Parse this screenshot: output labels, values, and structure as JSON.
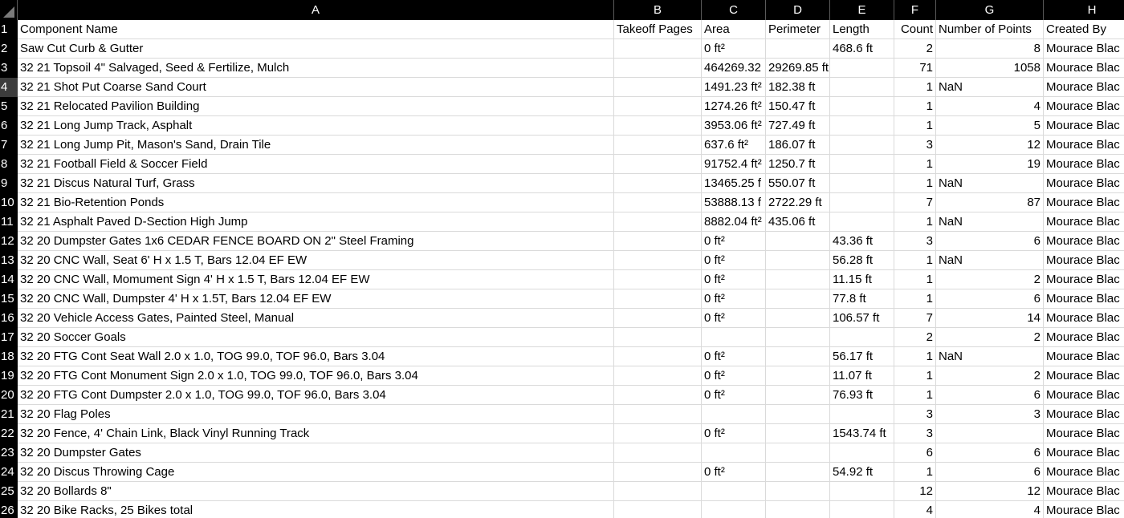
{
  "columns": [
    "A",
    "B",
    "C",
    "D",
    "E",
    "F",
    "G",
    "H"
  ],
  "selected_row": "4",
  "rows": [
    {
      "rn": "1",
      "a": "Component Name",
      "b": "Takeoff Pages",
      "c": "Area",
      "d": "Perimeter",
      "e": "Length",
      "f": "Count",
      "g": "Number of Points",
      "h": "Created By"
    },
    {
      "rn": "2",
      "a": "Saw Cut Curb & Gutter",
      "b": "",
      "c": "0 ft²",
      "d": "",
      "e": "468.6 ft",
      "f": "2",
      "g": "8",
      "h": "Mourace Blac"
    },
    {
      "rn": "3",
      "a": "32 21 Topsoil 4\" Salvaged, Seed & Fertilize, Mulch",
      "b": "",
      "c": "464269.32",
      "d": "29269.85 ft",
      "e": "",
      "f": "71",
      "g": "1058",
      "h": "Mourace Blac"
    },
    {
      "rn": "4",
      "a": "32 21 Shot Put Coarse Sand Court",
      "b": "",
      "c": "1491.23 ft²",
      "d": "182.38 ft",
      "e": "",
      "f": "1",
      "g": "NaN",
      "h": "Mourace Blac"
    },
    {
      "rn": "5",
      "a": "32 21 Relocated Pavilion Building",
      "b": "",
      "c": "1274.26 ft²",
      "d": "150.47 ft",
      "e": "",
      "f": "1",
      "g": "4",
      "h": "Mourace Blac"
    },
    {
      "rn": "6",
      "a": "32 21 Long Jump Track, Asphalt",
      "b": "",
      "c": "3953.06 ft²",
      "d": "727.49 ft",
      "e": "",
      "f": "1",
      "g": "5",
      "h": "Mourace Blac"
    },
    {
      "rn": "7",
      "a": "32 21 Long Jump Pit, Mason's Sand, Drain Tile",
      "b": "",
      "c": "637.6 ft²",
      "d": "186.07 ft",
      "e": "",
      "f": "3",
      "g": "12",
      "h": "Mourace Blac"
    },
    {
      "rn": "8",
      "a": "32 21 Football Field & Soccer Field",
      "b": "",
      "c": "91752.4 ft²",
      "d": "1250.7 ft",
      "e": "",
      "f": "1",
      "g": "19",
      "h": "Mourace Blac"
    },
    {
      "rn": "9",
      "a": "32 21 Discus Natural Turf, Grass",
      "b": "",
      "c": "13465.25 f",
      "d": "550.07 ft",
      "e": "",
      "f": "1",
      "g": "NaN",
      "h": "Mourace Blac"
    },
    {
      "rn": "10",
      "a": "32 21 Bio-Retention Ponds",
      "b": "",
      "c": "53888.13 f",
      "d": "2722.29 ft",
      "e": "",
      "f": "7",
      "g": "87",
      "h": "Mourace Blac"
    },
    {
      "rn": "11",
      "a": "32 21 Asphalt Paved D-Section High Jump",
      "b": "",
      "c": "8882.04 ft²",
      "d": "435.06 ft",
      "e": "",
      "f": "1",
      "g": "NaN",
      "h": "Mourace Blac"
    },
    {
      "rn": "12",
      "a": "32 20 Dumpster Gates 1x6 CEDAR FENCE BOARD ON 2\" Steel Framing",
      "b": "",
      "c": "0 ft²",
      "d": "",
      "e": "43.36 ft",
      "f": "3",
      "g": "6",
      "h": "Mourace Blac"
    },
    {
      "rn": "13",
      "a": "32 20 CNC Wall, Seat 6' H x 1.5 T, Bars 12.04 EF EW",
      "b": "",
      "c": "0 ft²",
      "d": "",
      "e": "56.28 ft",
      "f": "1",
      "g": "NaN",
      "h": "Mourace Blac"
    },
    {
      "rn": "14",
      "a": "32 20 CNC Wall, Momument Sign 4' H x 1.5 T, Bars 12.04 EF EW",
      "b": "",
      "c": "0 ft²",
      "d": "",
      "e": "11.15 ft",
      "f": "1",
      "g": "2",
      "h": "Mourace Blac"
    },
    {
      "rn": "15",
      "a": "32 20 CNC Wall, Dumpster 4' H x 1.5T, Bars 12.04 EF EW",
      "b": "",
      "c": "0 ft²",
      "d": "",
      "e": "77.8 ft",
      "f": "1",
      "g": "6",
      "h": "Mourace Blac"
    },
    {
      "rn": "16",
      "a": "32 20 Vehicle Access Gates, Painted Steel, Manual",
      "b": "",
      "c": "0 ft²",
      "d": "",
      "e": "106.57 ft",
      "f": "7",
      "g": "14",
      "h": "Mourace Blac"
    },
    {
      "rn": "17",
      "a": "32 20 Soccer Goals",
      "b": "",
      "c": "",
      "d": "",
      "e": "",
      "f": "2",
      "g": "2",
      "h": "Mourace Blac"
    },
    {
      "rn": "18",
      "a": "32 20 FTG Cont Seat Wall 2.0 x 1.0, TOG 99.0, TOF 96.0, Bars 3.04",
      "b": "",
      "c": "0 ft²",
      "d": "",
      "e": "56.17 ft",
      "f": "1",
      "g": "NaN",
      "h": "Mourace Blac"
    },
    {
      "rn": "19",
      "a": "32 20 FTG Cont Monument Sign 2.0 x 1.0, TOG 99.0, TOF 96.0, Bars 3.04",
      "b": "",
      "c": "0 ft²",
      "d": "",
      "e": "11.07 ft",
      "f": "1",
      "g": "2",
      "h": "Mourace Blac"
    },
    {
      "rn": "20",
      "a": "32 20 FTG Cont Dumpster 2.0 x 1.0, TOG 99.0, TOF 96.0, Bars 3.04",
      "b": "",
      "c": "0 ft²",
      "d": "",
      "e": "76.93 ft",
      "f": "1",
      "g": "6",
      "h": "Mourace Blac"
    },
    {
      "rn": "21",
      "a": "32 20 Flag Poles",
      "b": "",
      "c": "",
      "d": "",
      "e": "",
      "f": "3",
      "g": "3",
      "h": "Mourace Blac"
    },
    {
      "rn": "22",
      "a": "32 20 Fence, 4' Chain Link, Black Vinyl Running Track",
      "b": "",
      "c": "0 ft²",
      "d": "",
      "e": "1543.74 ft",
      "f": "3",
      "g": "",
      "h": "Mourace Blac"
    },
    {
      "rn": "23",
      "a": "32 20 Dumpster Gates",
      "b": "",
      "c": "",
      "d": "",
      "e": "",
      "f": "6",
      "g": "6",
      "h": "Mourace Blac"
    },
    {
      "rn": "24",
      "a": "32 20 Discus Throwing Cage",
      "b": "",
      "c": "0 ft²",
      "d": "",
      "e": "54.92 ft",
      "f": "1",
      "g": "6",
      "h": "Mourace Blac"
    },
    {
      "rn": "25",
      "a": "32 20 Bollards 8\"",
      "b": "",
      "c": "",
      "d": "",
      "e": "",
      "f": "12",
      "g": "12",
      "h": "Mourace Blac"
    },
    {
      "rn": "26",
      "a": "32 20 Bike Racks, 25 Bikes total",
      "b": "",
      "c": "",
      "d": "",
      "e": "",
      "f": "4",
      "g": "4",
      "h": "Mourace Blac"
    }
  ]
}
